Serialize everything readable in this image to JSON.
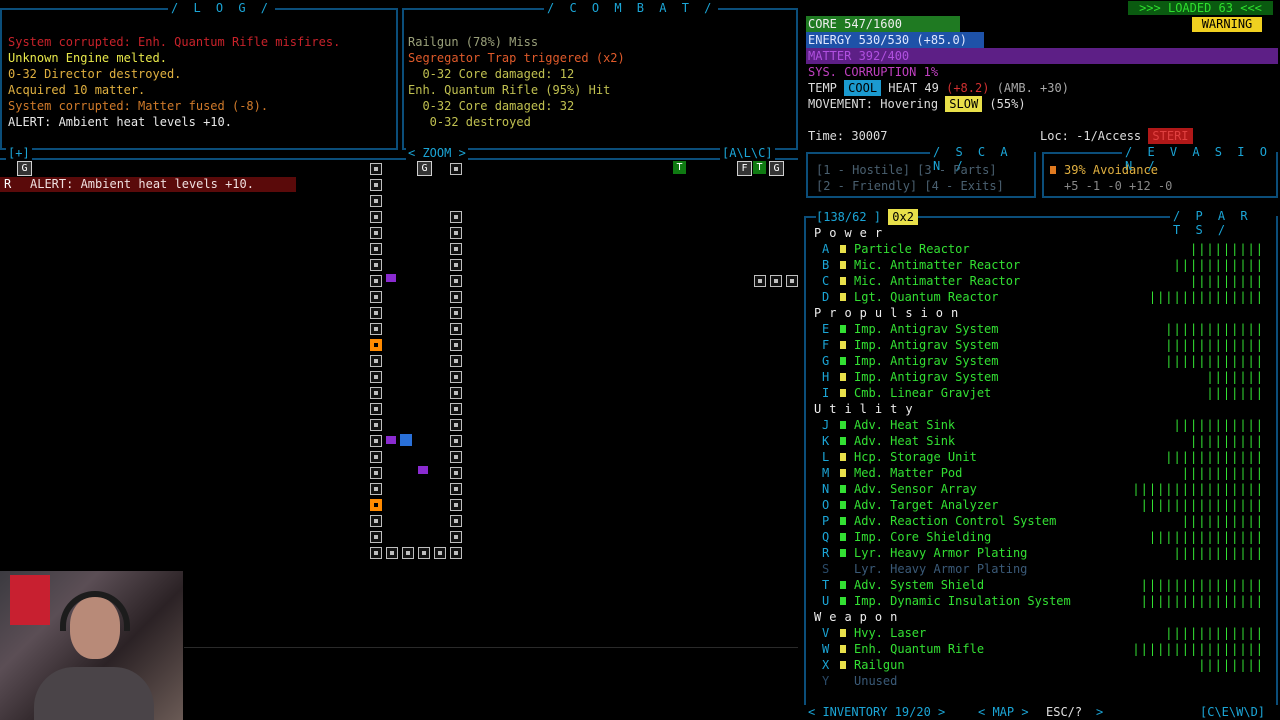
{
  "log": {
    "title": "/ L O G /",
    "lines": [
      {
        "text": "System corrupted: Enh. Quantum Rifle misfires.",
        "color": "#c8222a"
      },
      {
        "text": "Unknown Engine melted.",
        "color": "#e8e84a"
      },
      {
        "text": "0-32 Director destroyed.",
        "color": "#e0b040"
      },
      {
        "text": "Acquired 10 matter.",
        "color": "#e0b040"
      },
      {
        "text": "System corrupted: Matter fused (-8).",
        "color": "#d07a2a"
      },
      {
        "text": "ALERT: Ambient heat levels +10.",
        "color": "#e8e8e8"
      }
    ]
  },
  "combat": {
    "title": "/ C O M B A T /",
    "lines": [
      {
        "text": "Railgun (78%) Miss",
        "color": "#9aa07a"
      },
      {
        "text": "Segregator Trap triggered (x2)",
        "color": "#e05a2a"
      },
      {
        "text": "  0-32 Core damaged: 12",
        "color": "#c0c050"
      },
      {
        "text": "Enh. Quantum Rifle (95%) Hit",
        "color": "#c0c050"
      },
      {
        "text": "  0-32 Core damaged: 32",
        "color": "#c0c050"
      },
      {
        "text": "   0-32 destroyed",
        "color": "#c0c050"
      }
    ]
  },
  "status": {
    "loaded": ">>> LOADED 63 <<<",
    "warning": "WARNING",
    "core": "CORE   547/1600",
    "energy": "ENERGY 530/530 (+85.0)",
    "matter": "MATTER 392/400",
    "corruption": "SYS. CORRUPTION 1%",
    "temp_label": "TEMP",
    "temp_state": "COOL",
    "heat": "HEAT 49",
    "heat_delta": "(+8.2)",
    "heat_amb": "(AMB. +30)",
    "movement_label": "MOVEMENT: Hovering",
    "movement_state": "SLOW",
    "movement_pct": "(55%)",
    "time": "Time: 30007",
    "location": "Loc: -1/Access",
    "loc_tag": "STERI"
  },
  "map_header": {
    "left": "[+]",
    "zoom": "< ZOOM >",
    "right": "[A\\L\\C]"
  },
  "alert_bar": {
    "icon": "R",
    "text": "ALERT: Ambient heat levels +10."
  },
  "markers": {
    "g_left": "G",
    "g_mid": "G",
    "t_green": "T",
    "f": "F",
    "t": "T",
    "g_right": "G"
  },
  "scan": {
    "title": "/ S C A N /",
    "line1": "[1 - Hostile]  [3 - Parts]",
    "line2": "[2 - Friendly] [4 - Exits]"
  },
  "evasion": {
    "title": "/ E V A S I O N /",
    "avoidance": "39% Avoidance",
    "values": "+5 -1 -0 +12 -0"
  },
  "parts": {
    "title": "/ P A R T S /",
    "slots": "[138/62 ]",
    "multiplier": "0x2",
    "sections": [
      {
        "name": "Power",
        "items": [
          {
            "key": "A",
            "name": "Particle Reactor",
            "sq": "#e8e04a",
            "bar": "|||||||||"
          },
          {
            "key": "B",
            "name": "Mic. Antimatter Reactor",
            "sq": "#e8e04a",
            "bar": "|||||||||||"
          },
          {
            "key": "C",
            "name": "Mic. Antimatter Reactor",
            "sq": "#e8e04a",
            "bar": "|||||||||"
          },
          {
            "key": "D",
            "name": "Lgt. Quantum Reactor",
            "sq": "#e8e04a",
            "bar": "||||||||||||||"
          }
        ]
      },
      {
        "name": "Propulsion",
        "items": [
          {
            "key": "E",
            "name": "Imp. Antigrav System",
            "sq": "#33e033",
            "bar": "||||||||||||"
          },
          {
            "key": "F",
            "name": "Imp. Antigrav System",
            "sq": "#e8e04a",
            "bar": "||||||||||||"
          },
          {
            "key": "G",
            "name": "Imp. Antigrav System",
            "sq": "#33e033",
            "bar": "||||||||||||"
          },
          {
            "key": "H",
            "name": "Imp. Antigrav System",
            "sq": "#e8e04a",
            "bar": "|||||||"
          },
          {
            "key": "I",
            "name": "Cmb. Linear Gravjet",
            "sq": "#e8e04a",
            "bar": "|||||||"
          }
        ]
      },
      {
        "name": "Utility",
        "items": [
          {
            "key": "J",
            "name": "Adv. Heat Sink",
            "sq": "#33e033",
            "bar": "|||||||||||"
          },
          {
            "key": "K",
            "name": "Adv. Heat Sink",
            "sq": "#33e033",
            "bar": "|||||||||"
          },
          {
            "key": "L",
            "name": "Hcp. Storage Unit",
            "sq": "#e8e04a",
            "bar": "||||||||||||"
          },
          {
            "key": "M",
            "name": "Med. Matter Pod",
            "sq": "#e8e04a",
            "bar": "||||||||||"
          },
          {
            "key": "N",
            "name": "Adv. Sensor Array",
            "sq": "#33e033",
            "bar": "||||||||||||||||"
          },
          {
            "key": "O",
            "name": "Adv. Target Analyzer",
            "sq": "#33e033",
            "bar": "|||||||||||||||"
          },
          {
            "key": "P",
            "name": "Adv. Reaction Control System",
            "sq": "#33e033",
            "bar": "||||||||||"
          },
          {
            "key": "Q",
            "name": "Imp. Core Shielding",
            "sq": "#33e033",
            "bar": "||||||||||||||"
          },
          {
            "key": "R",
            "name": "Lyr. Heavy Armor Plating",
            "sq": "#33e033",
            "bar": "|||||||||||"
          },
          {
            "key": "S",
            "name": "Lyr. Heavy Armor Plating",
            "sq": "#000000",
            "bar": "",
            "dim": true
          },
          {
            "key": "T",
            "name": "Adv. System Shield",
            "sq": "#33e033",
            "bar": "|||||||||||||||"
          },
          {
            "key": "U",
            "name": "Imp. Dynamic Insulation System",
            "sq": "#33e033",
            "bar": "|||||||||||||||"
          }
        ]
      },
      {
        "name": "Weapon",
        "items": [
          {
            "key": "V",
            "name": "Hvy. Laser",
            "sq": "#e8e04a",
            "bar": "||||||||||||"
          },
          {
            "key": "W",
            "name": "Enh. Quantum Rifle",
            "sq": "#e8e04a",
            "bar": "||||||||||||||||"
          },
          {
            "key": "X",
            "name": "Railgun",
            "sq": "#e8e04a",
            "bar": "||||||||"
          },
          {
            "key": "Y",
            "name": "Unused",
            "sq": "#000000",
            "bar": "",
            "dim": true
          }
        ]
      }
    ]
  },
  "footer": {
    "inventory": "< INVENTORY 19/20 >",
    "map": "< MAP >",
    "esc": "ESC/?",
    "arrow": ">",
    "right": "[C\\E\\W\\D]"
  }
}
